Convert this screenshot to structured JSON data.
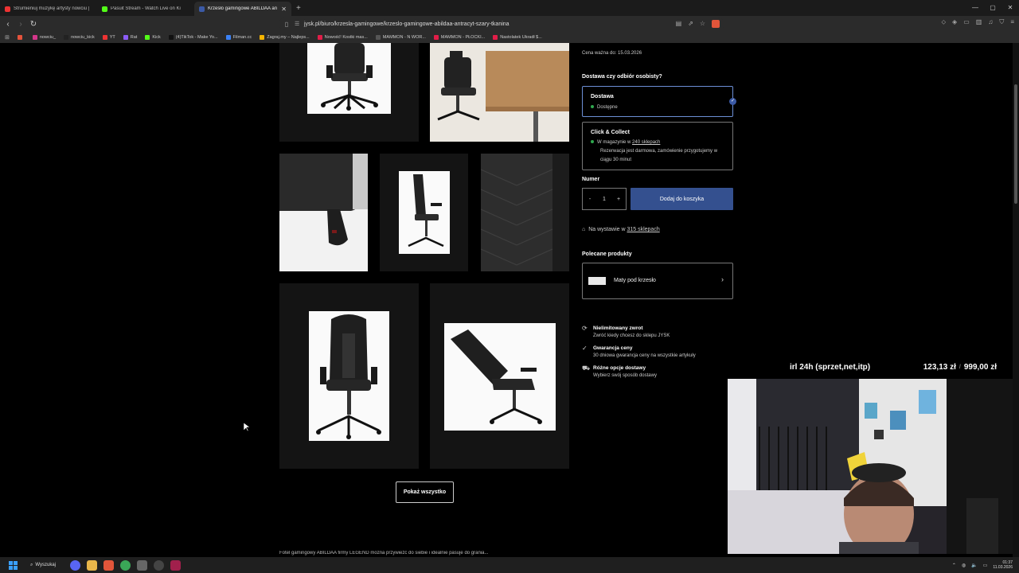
{
  "browser": {
    "tabs": [
      {
        "label": "Strumieniuj muzykę artysty nowciu |",
        "icon": "youtube-icon",
        "color": "#e33",
        "active": false
      },
      {
        "label": "Pasuit Stream - Watch Live on Ki",
        "icon": "kick-icon",
        "color": "#53fc18",
        "active": false
      },
      {
        "label": "Krzesło gamingowe ABILDAA an",
        "icon": "jysk-icon",
        "color": "#3b5aa6",
        "active": true
      }
    ],
    "new_tab": "+",
    "url": "jysk.pl/biuro/krzesla-gamingowe/krzeslo-gamingowe-abildaa-antracyt-szary-tkanina",
    "bookmarks": [
      {
        "label": "",
        "color": "#e5533c"
      },
      {
        "label": "nowciu_",
        "color": "#d4368a"
      },
      {
        "label": "nowciu_kick",
        "color": "#222"
      },
      {
        "label": "YT",
        "color": "#e33"
      },
      {
        "label": "Rat",
        "color": "#8b5cf6"
      },
      {
        "label": "Kick",
        "color": "#53fc18"
      },
      {
        "label": "(4)TikTok - Make Yo...",
        "color": "#111"
      },
      {
        "label": "Filman.cc",
        "color": "#3b82f6"
      },
      {
        "label": "Zagraj.my – Najleps...",
        "color": "#f5b400"
      },
      {
        "label": "Nowość! Kostki mas...",
        "color": "#e11d48"
      },
      {
        "label": "MAMMON - N WOR...",
        "color": "#555"
      },
      {
        "label": "MAMMON - PŁOCKI...",
        "color": "#e11d48"
      },
      {
        "label": "Nastolatek Ukradł $...",
        "color": "#e11d48"
      }
    ]
  },
  "product": {
    "price_valid": "Cena ważna do: 15.03.2026",
    "delivery_question": "Dostawa czy odbiór osobisty?",
    "delivery_option": {
      "title": "Dostawa",
      "status": "Dostępne"
    },
    "collect_option": {
      "title": "Click & Collect",
      "stock_prefix": "W magazynie w ",
      "stock_link": "240 sklepach",
      "note": "Rezerwacja jest darmowa, zamówienie przygotujemy w ciągu 30 minut"
    },
    "quantity_label": "Numer",
    "quantity_minus": "-",
    "quantity_value": "1",
    "quantity_plus": "+",
    "add_to_cart": "Dodaj do koszyka",
    "display_prefix": "Na wystawie w ",
    "display_link": "315 sklepach",
    "recommended_title": "Polecane produkty",
    "recommended_item": "Maty pod krzesło",
    "benefits": [
      {
        "title": "Nielimitowany zwrot",
        "text": "Zwróć kiedy chcesz do sklepu JYSK",
        "icon": "return-icon"
      },
      {
        "title": "Gwarancja ceny",
        "text": "30 dniowa gwarancja ceny na wszystkie artykuły",
        "icon": "price-guarantee-icon"
      },
      {
        "title": "Różne opcje dostawy",
        "text": "Wybierz swój sposób dostawy",
        "icon": "delivery-truck-icon"
      }
    ],
    "show_all": "Pokaż wszystko",
    "description_cut": "Fotel gamingowy ABILDAA firmy LEGEND można przywieźć do siebie i idealnie pasuje do grania..."
  },
  "overlay": {
    "goal_label": "irl 24h (sprzet,net,itp)",
    "goal_current": "123,13 zł",
    "goal_target": "999,00 zł"
  },
  "taskbar": {
    "search": "Wyszukaj",
    "time": "01:37",
    "date": "11.03.2026"
  }
}
